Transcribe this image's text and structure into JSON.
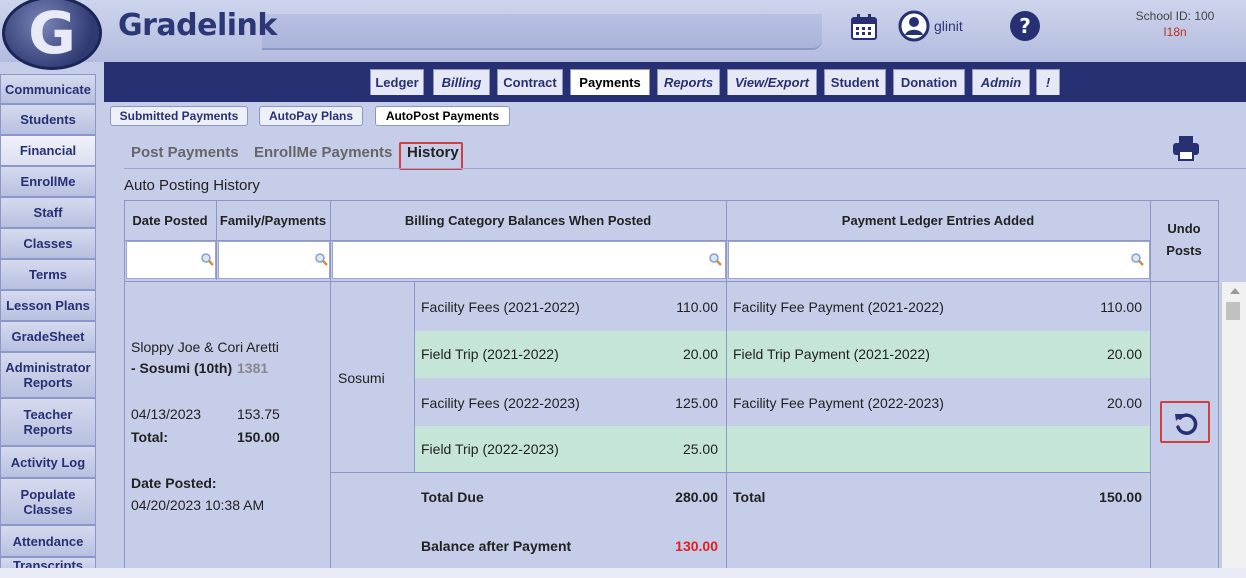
{
  "app": {
    "brand": "Gradelink",
    "logo_letter": "G",
    "user_name": "glinit",
    "school_id_label": "School ID: 100",
    "school_code": "I18n"
  },
  "nav_tabs": [
    {
      "label": "Ledger"
    },
    {
      "label": "Billing"
    },
    {
      "label": "Contract"
    },
    {
      "label": "Payments"
    },
    {
      "label": "Reports"
    },
    {
      "label": "View/Export"
    },
    {
      "label": "Student"
    },
    {
      "label": "Donation"
    },
    {
      "label": "Admin"
    },
    {
      "label": "!"
    }
  ],
  "sidebar": [
    {
      "label": "Communicate"
    },
    {
      "label": "Students"
    },
    {
      "label": "Financial"
    },
    {
      "label": "EnrollMe"
    },
    {
      "label": "Staff"
    },
    {
      "label": "Classes"
    },
    {
      "label": "Terms"
    },
    {
      "label": "Lesson Plans"
    },
    {
      "label": "GradeSheet"
    },
    {
      "label": "Administrator Reports"
    },
    {
      "label": "Teacher Reports"
    },
    {
      "label": "Activity Log"
    },
    {
      "label": "Populate Classes"
    },
    {
      "label": "Attendance"
    },
    {
      "label": "Transcripts"
    }
  ],
  "sub_tabs": [
    {
      "label": "Submitted Payments"
    },
    {
      "label": "AutoPay Plans"
    },
    {
      "label": "AutoPost Payments"
    }
  ],
  "sub_tabs2": [
    {
      "label": "Post Payments"
    },
    {
      "label": "EnrollMe Payments"
    },
    {
      "label": "History"
    }
  ],
  "section_title": "Auto Posting History",
  "table": {
    "headers": {
      "date_posted": "Date Posted",
      "family_payments": "Family/Payments",
      "billing_balances": "Billing Category Balances When Posted",
      "ledger_entries": "Payment Ledger Entries Added",
      "undo_posts": "Undo Posts"
    },
    "row": {
      "family_name": "Sloppy Joe & Cori Aretti",
      "student": "- Sosumi (10th)",
      "student_id": "1381",
      "payment_date": "04/13/2023",
      "payment_amount": "153.75",
      "total_label": "Total:",
      "total_value": "150.00",
      "date_posted_label": "Date Posted:",
      "date_posted_value": "04/20/2023 10:38 AM",
      "student_short": "Sosumi",
      "billing": [
        {
          "category": "Facility Fees (2021-2022)",
          "amount": "110.00"
        },
        {
          "category": "Field Trip (2021-2022)",
          "amount": "20.00"
        },
        {
          "category": "Facility Fees (2022-2023)",
          "amount": "125.00"
        },
        {
          "category": "Field Trip (2022-2023)",
          "amount": "25.00"
        }
      ],
      "ledger": [
        {
          "entry": "Facility Fee Payment (2021-2022)",
          "amount": "110.00"
        },
        {
          "entry": "Field Trip Payment (2021-2022)",
          "amount": "20.00"
        },
        {
          "entry": "Facility Fee Payment (2022-2023)",
          "amount": "20.00"
        },
        {
          "entry": "",
          "amount": ""
        }
      ],
      "total_due_label": "Total Due",
      "total_due_value": "280.00",
      "balance_label": "Balance after Payment",
      "balance_value": "130.00",
      "ledger_total_label": "Total",
      "ledger_total_value": "150.00"
    }
  },
  "colors": {
    "nav_bg": "#283074",
    "green_row": "#c5e6d6",
    "highlight_red": "#d04040",
    "balance_red": "#e02020"
  }
}
